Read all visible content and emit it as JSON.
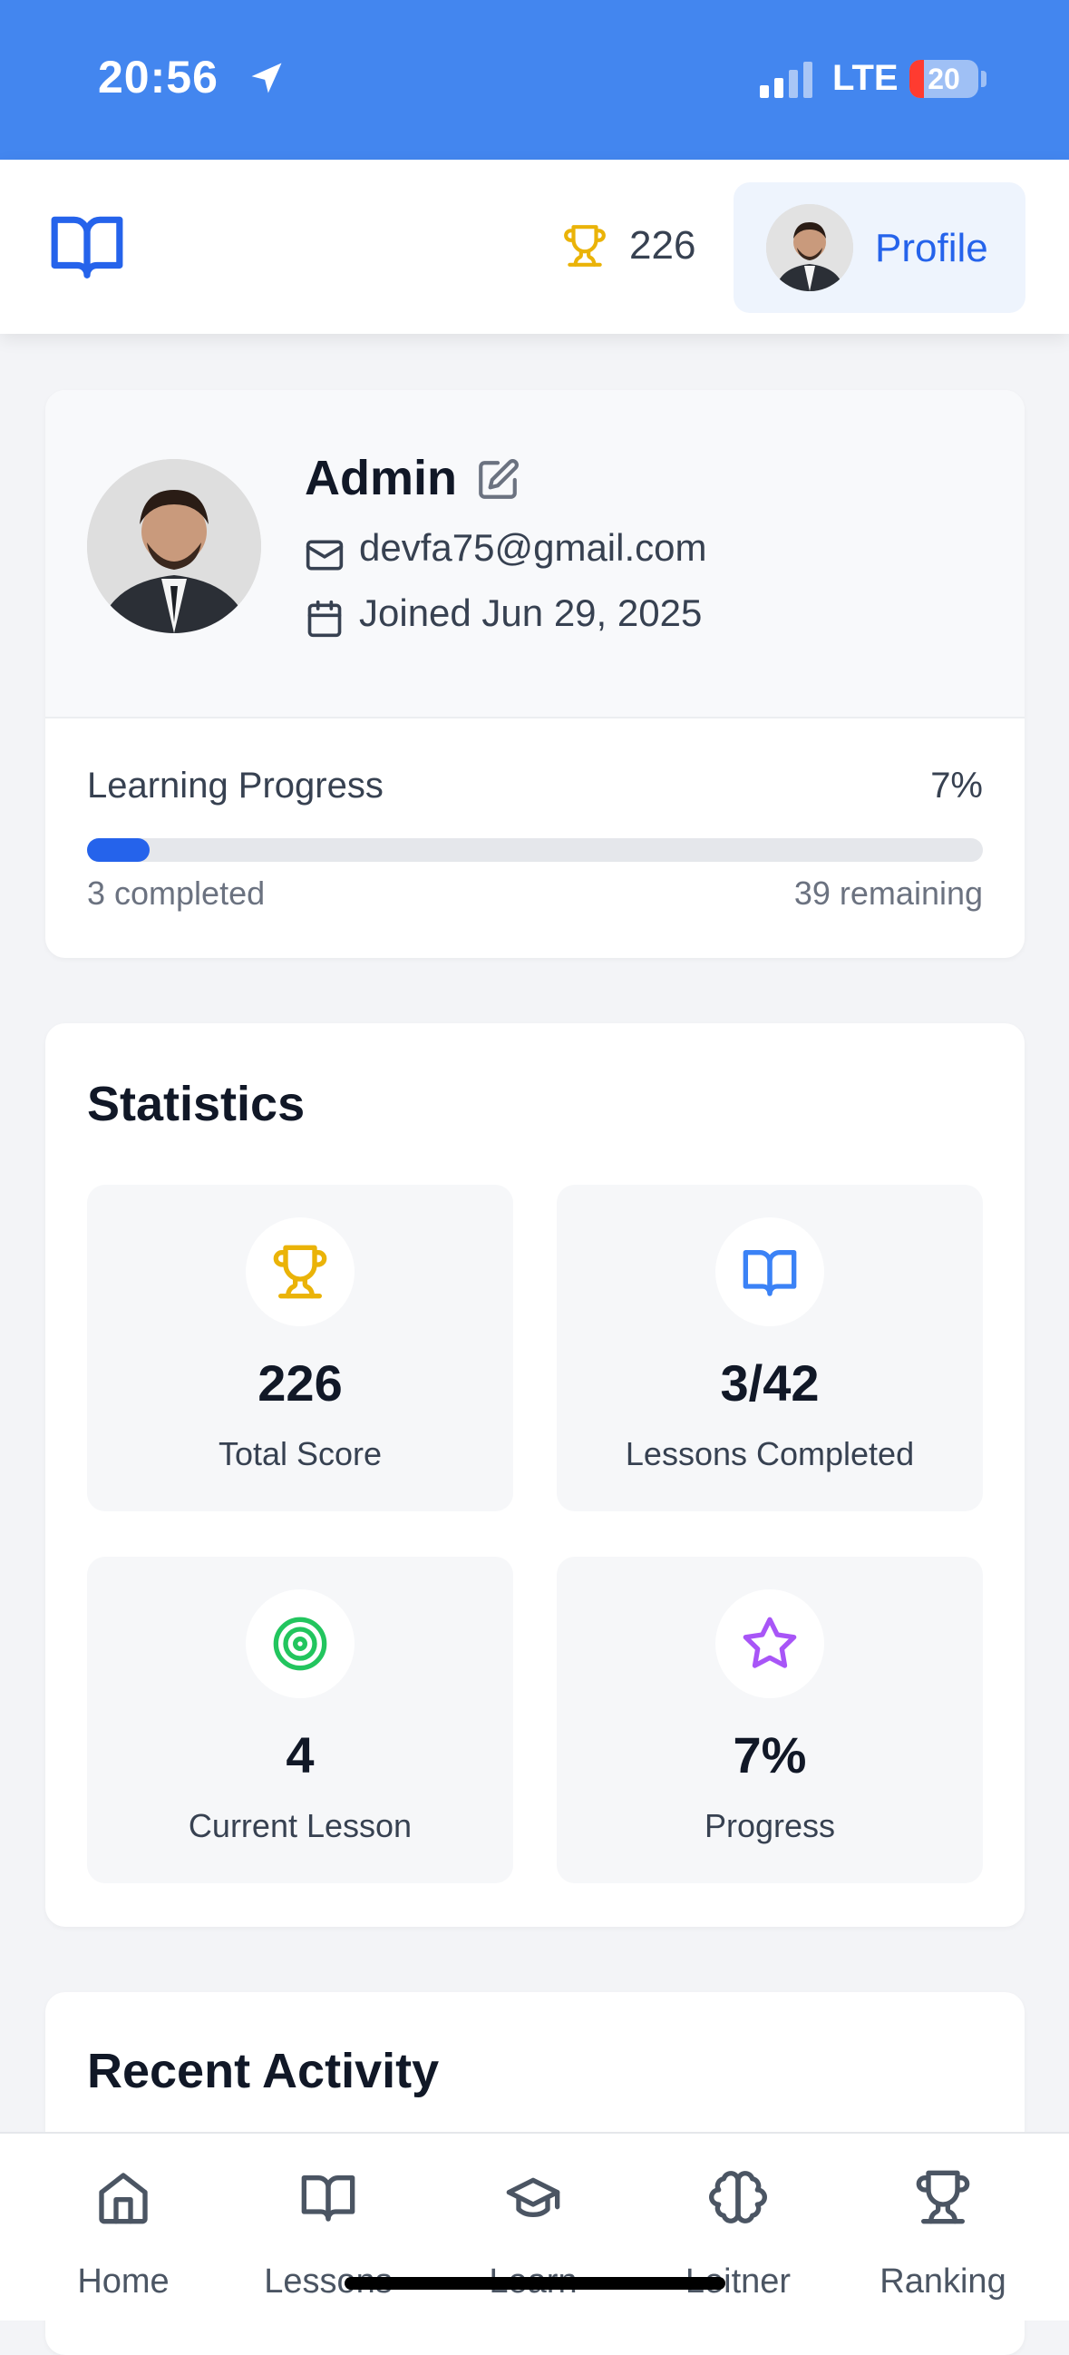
{
  "status_bar": {
    "time": "20:56",
    "network": "LTE",
    "battery": "20"
  },
  "header": {
    "logo_icon": "open-book-icon",
    "score_icon": "trophy-icon",
    "score": "226",
    "profile_label": "Profile"
  },
  "profile": {
    "name": "Admin",
    "email": "devfa75@gmail.com",
    "joined": "Joined Jun 29, 2025",
    "progress_title": "Learning Progress",
    "progress_percent": "7%",
    "progress_value": 0.07,
    "completed_text": "3 completed",
    "remaining_text": "39 remaining"
  },
  "statistics": {
    "title": "Statistics",
    "items": [
      {
        "value": "226",
        "label": "Total Score",
        "icon": "trophy-icon",
        "color": "#eab308"
      },
      {
        "value": "3/42",
        "label": "Lessons Completed",
        "icon": "book-icon",
        "color": "#3b82f6"
      },
      {
        "value": "4",
        "label": "Current Lesson",
        "icon": "target-icon",
        "color": "#22c55e"
      },
      {
        "value": "7%",
        "label": "Progress",
        "icon": "star-icon",
        "color": "#a855f7"
      }
    ]
  },
  "recent_activity": {
    "title": "Recent Activity"
  },
  "bottom_nav": {
    "items": [
      {
        "label": "Home",
        "icon": "home-icon"
      },
      {
        "label": "Lessons",
        "icon": "book-icon"
      },
      {
        "label": "Learn",
        "icon": "graduation-cap-icon"
      },
      {
        "label": "Leitner",
        "icon": "brain-icon"
      },
      {
        "label": "Ranking",
        "icon": "trophy-icon"
      }
    ]
  },
  "colors": {
    "accent": "#2563eb",
    "status_bar": "#4386ef",
    "background": "#f3f4f7"
  }
}
